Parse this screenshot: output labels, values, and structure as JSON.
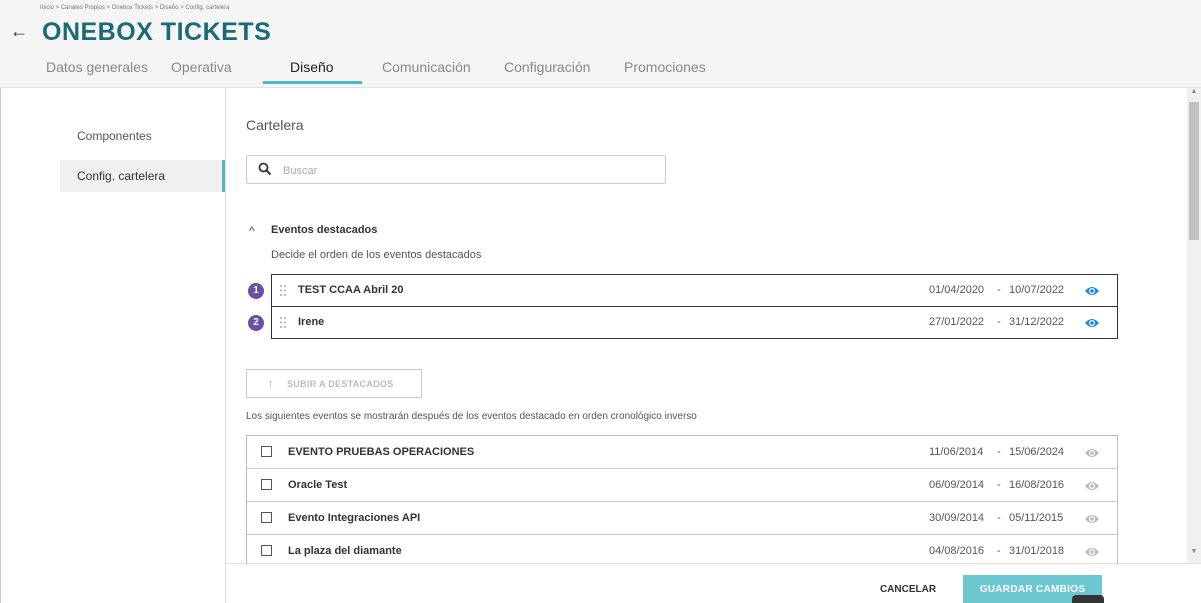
{
  "header": {
    "breadcrumb": "Inicio > Canales Propios > Onebox Tickets > Diseño > Config. cartelera",
    "back_icon": "arrow-left-icon",
    "title": "ONEBOX TICKETS",
    "title_color": "#1a6b73",
    "tabs": [
      {
        "label": "Datos generales"
      },
      {
        "label": "Operativa"
      },
      {
        "label": "Diseño"
      },
      {
        "label": "Comunicación"
      },
      {
        "label": "Configuración"
      },
      {
        "label": "Promociones"
      }
    ],
    "active_tab": "Diseño",
    "accent_color": "#4fb6c4"
  },
  "sidebar": {
    "items": [
      {
        "label": "Componentes"
      },
      {
        "label": "Config. cartelera"
      }
    ],
    "active_item": "Config. cartelera"
  },
  "main": {
    "section_title": "Cartelera",
    "search": {
      "placeholder": "Buscar",
      "value": ""
    },
    "featured": {
      "title": "Eventos destacados",
      "description": "Decide el orden de los eventos destacados",
      "items": [
        {
          "order": "1",
          "name": "TEST CCAA Abril 20",
          "start": "01/04/2020",
          "end": "10/07/2022"
        },
        {
          "order": "2",
          "name": "Irene",
          "start": "27/01/2022",
          "end": "31/12/2022"
        }
      ],
      "badge_color": "#6a4fa8",
      "eye_color": "#1e88e5"
    },
    "upload_button": "SUBIR A DESTACADOS",
    "info_text": "Los siguientes eventos se mostrarán después de los eventos destacado en orden cronológico inverso",
    "date_separator": "-",
    "events": [
      {
        "name": "EVENTO PRUEBAS OPERACIONES",
        "start": "11/06/2014",
        "end": "15/06/2024"
      },
      {
        "name": "Oracle Test",
        "start": "06/09/2014",
        "end": "16/08/2016"
      },
      {
        "name": "Evento Integraciones API",
        "start": "30/09/2014",
        "end": "05/11/2015"
      },
      {
        "name": "La plaza del diamante",
        "start": "04/08/2016",
        "end": "31/01/2018"
      }
    ]
  },
  "footer": {
    "cancel_label": "CANCELAR",
    "save_label": "GUARDAR CAMBIOS",
    "save_color": "#6cc7d1"
  }
}
